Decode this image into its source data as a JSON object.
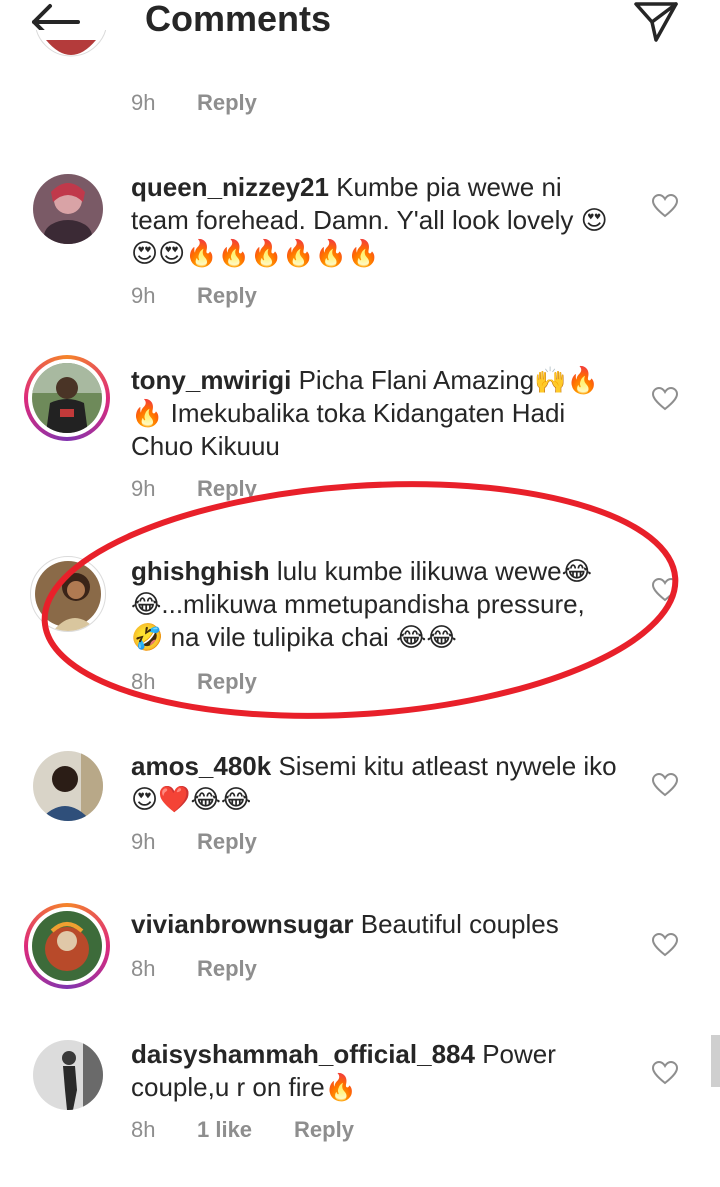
{
  "header": {
    "title": "Comments",
    "back_icon": "arrow-left-icon",
    "send_icon": "paper-plane-icon"
  },
  "top_partial": {
    "time": "9h",
    "reply": "Reply"
  },
  "comments": [
    {
      "username": "queen_nizzey21",
      "text": "Kumbe pia wewe ni team forehead. Damn. Y'all look lovely 😍😍😍🔥🔥🔥🔥🔥🔥",
      "time": "9h",
      "reply": "Reply"
    },
    {
      "username": "tony_mwirigi",
      "text": "Picha Flani Amazing🙌🔥🔥 Imekubalika toka Kidangaten Hadi Chuo Kikuuu",
      "time": "9h",
      "reply": "Reply"
    },
    {
      "username": "ghishghish",
      "text": "lulu kumbe ilikuwa wewe😂😂...mlikuwa mmetupandisha pressure, 🤣 na vile tulipika chai 😂😂",
      "time": "8h",
      "reply": "Reply"
    },
    {
      "username": "amos_480k",
      "text": "Sisemi kitu atleast nywele iko😍❤️😂😂",
      "time": "9h",
      "reply": "Reply"
    },
    {
      "username": "vivianbrownsugar",
      "text": "Beautiful couples",
      "time": "8h",
      "reply": "Reply"
    },
    {
      "username": "daisyshammah_official_884",
      "text": "Power couple,u r on fire🔥",
      "time": "8h",
      "likes": "1 like",
      "reply": "Reply"
    }
  ],
  "colors": {
    "text": "#262626",
    "meta": "#8e8e8e",
    "annotation_oval": "#e8202a",
    "story_ring": "#dd2a7b"
  }
}
